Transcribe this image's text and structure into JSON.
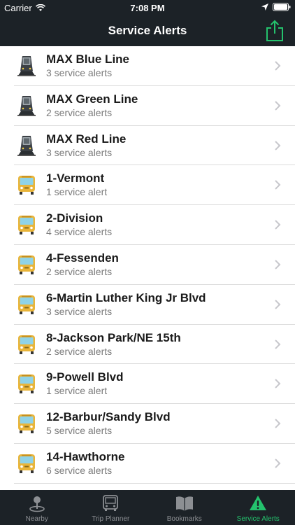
{
  "status_bar": {
    "carrier": "Carrier",
    "time": "7:08 PM"
  },
  "nav": {
    "title": "Service Alerts",
    "share_icon": "share-icon"
  },
  "alerts": [
    {
      "name": "MAX Blue Line",
      "subtitle": "3 service alerts",
      "icon": "train-icon"
    },
    {
      "name": "MAX Green Line",
      "subtitle": "2 service alerts",
      "icon": "train-icon"
    },
    {
      "name": "MAX Red Line",
      "subtitle": "3 service alerts",
      "icon": "train-icon"
    },
    {
      "name": "1-Vermont",
      "subtitle": "1 service alert",
      "icon": "bus-icon"
    },
    {
      "name": "2-Division",
      "subtitle": "4 service alerts",
      "icon": "bus-icon"
    },
    {
      "name": "4-Fessenden",
      "subtitle": "2 service alerts",
      "icon": "bus-icon"
    },
    {
      "name": "6-Martin Luther King Jr Blvd",
      "subtitle": "3 service alerts",
      "icon": "bus-icon"
    },
    {
      "name": "8-Jackson Park/NE 15th",
      "subtitle": "2 service alerts",
      "icon": "bus-icon"
    },
    {
      "name": "9-Powell Blvd",
      "subtitle": "1 service alert",
      "icon": "bus-icon"
    },
    {
      "name": "12-Barbur/Sandy Blvd",
      "subtitle": "5 service alerts",
      "icon": "bus-icon"
    },
    {
      "name": "14-Hawthorne",
      "subtitle": "6 service alerts",
      "icon": "bus-icon"
    }
  ],
  "tabs": [
    {
      "label": "Nearby",
      "icon": "map-pin-icon"
    },
    {
      "label": "Trip Planner",
      "icon": "bus-front-icon"
    },
    {
      "label": "Bookmarks",
      "icon": "book-icon"
    },
    {
      "label": "Service Alerts",
      "icon": "alert-icon",
      "active": true
    }
  ],
  "colors": {
    "bar_background": "#1c2227",
    "accent": "#24c26d",
    "inactive_tab": "#8c8f93"
  }
}
